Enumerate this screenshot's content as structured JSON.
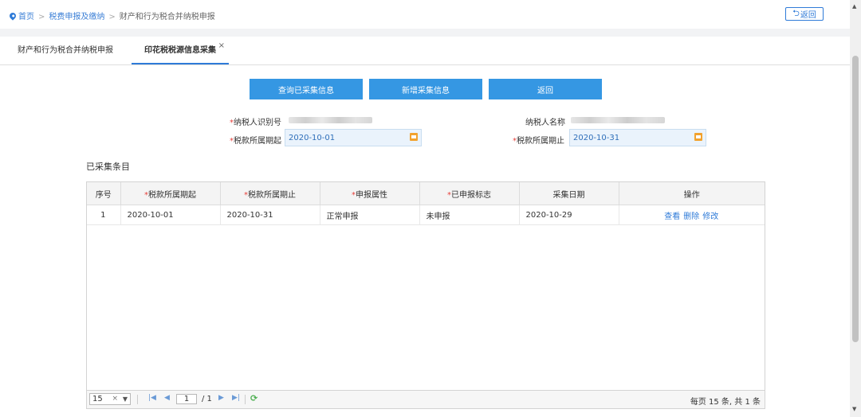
{
  "breadcrumb": {
    "home": "首页",
    "level1": "税费申报及缴纳",
    "current": "财产和行为税合并纳税申报",
    "separator": ">"
  },
  "header": {
    "back_label": "返回",
    "back_icon": "return-arrow-icon"
  },
  "tabs": [
    {
      "label": "财产和行为税合并纳税申报"
    },
    {
      "label": "印花税税源信息采集",
      "close": "×"
    }
  ],
  "actions": {
    "query_label": "查询已采集信息",
    "add_label": "新增采集信息",
    "back_label": "返回"
  },
  "form": {
    "required_mark": "*",
    "taxpayer_id_label": "纳税人识别号",
    "taxpayer_name_label": "纳税人名称",
    "period_start_label": "税款所属期起",
    "period_start_value": "2020-10-01",
    "period_end_label": "税款所属期止",
    "period_end_value": "2020-10-31"
  },
  "section_title": "已采集条目",
  "table": {
    "columns": [
      {
        "label": "序号",
        "required": false
      },
      {
        "label": "税款所属期起",
        "required": true
      },
      {
        "label": "税款所属期止",
        "required": true
      },
      {
        "label": "申报属性",
        "required": true
      },
      {
        "label": "已申报标志",
        "required": true
      },
      {
        "label": "采集日期",
        "required": false
      },
      {
        "label": "操作",
        "required": false
      }
    ],
    "rows": [
      {
        "index": "1",
        "start": "2020-10-01",
        "end": "2020-10-31",
        "attribute": "正常申报",
        "declared": "未申报",
        "collected": "2020-10-29",
        "ops": [
          "查看",
          "删除",
          "修改"
        ]
      }
    ]
  },
  "pager": {
    "page_size": "15",
    "clear": "×",
    "page_current": "1",
    "page_total": "/ 1",
    "summary": "每页 15 条, 共 1 条"
  },
  "colors": {
    "accent": "#2f7bd8",
    "button": "#3597e3",
    "required": "#e6413c"
  }
}
